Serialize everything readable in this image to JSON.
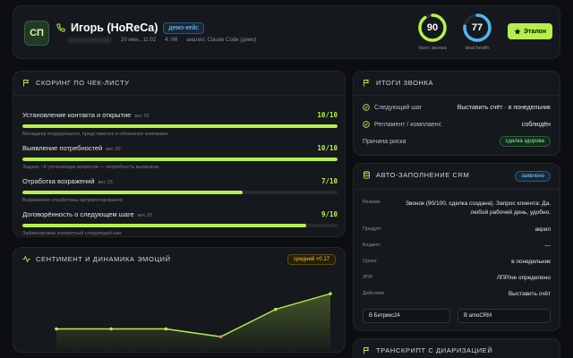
{
  "header": {
    "avatar": "СП",
    "client_name": "Игорь (HoReCa)",
    "demo_tag": "демо-кейс",
    "datetime": "20 июн., 11:02",
    "duration": "4:00",
    "analyzer": "анализ: Claude Code (демо)",
    "score": {
      "value": "90",
      "label": "балл звонка",
      "fraction": 0.9,
      "color": "#b5f04a"
    },
    "deal_health": {
      "value": "77",
      "label": "deal health",
      "fraction": 0.77,
      "color": "#4fb6f0"
    },
    "etalon_button": "Эталон"
  },
  "scoring": {
    "title": "СКОРИНГ ПО ЧЕК-ЛИСТУ",
    "criteria": [
      {
        "name": "Установление контакта и открытие",
        "weight": "вес 20",
        "score": "10/10",
        "fraction": 1.0,
        "note": "Менеджер поздоровался, представился и обозначил компанию."
      },
      {
        "name": "Выявление потребностей",
        "weight": "вес 30",
        "score": "10/10",
        "fraction": 1.0,
        "note": "Задано ~9 уточняющих вопросов — потребность выявлена."
      },
      {
        "name": "Отработка возражений",
        "weight": "вес 25",
        "score": "7/10",
        "fraction": 0.7,
        "note": "Возражения отработаны аргументированно."
      },
      {
        "name": "Договорённость о следующем шаге",
        "weight": "вес 25",
        "score": "9/10",
        "fraction": 0.9,
        "note": "Зафиксирован конкретный следующий шаг."
      }
    ]
  },
  "sentiment": {
    "title": "СЕНТИМЕНТ И ДИНАМИКА ЭМОЦИЙ",
    "badge": "средний +0.17"
  },
  "chart_data": {
    "type": "area",
    "title": "",
    "xlabel": "",
    "ylabel": "",
    "x": [
      0,
      1,
      2,
      3,
      4,
      5
    ],
    "series": [
      {
        "values": [
          0.0,
          0.0,
          0.0,
          -0.1,
          0.25,
          0.45
        ]
      }
    ],
    "ylim": [
      -0.2,
      0.6
    ],
    "point_colors": [
      "#b5f04a",
      "#b5f04a",
      "#b5f04a",
      "#f87171",
      "#b5f04a",
      "#b5f04a"
    ],
    "line_color": "#b5f04a",
    "grid": false
  },
  "summary": {
    "title": "ИТОГИ ЗВОНКА",
    "next_step_label": "Следующий шаг",
    "next_step_value": "Выставить счёт · в понедельник",
    "compliance_label": "Регламент / комплаенс",
    "compliance_value": "соблюдён",
    "risk_label": "Причина риска",
    "risk_value": "сделка здорова"
  },
  "autofill": {
    "title": "АВТО-ЗАПОЛНЕНИЕ CRM",
    "badge": "заявлено",
    "fields": [
      {
        "key": "Резюме",
        "value": "Звонок (90/100, сделка создана). Запрос клиента: Да, любой рабочий день, удобно."
      },
      {
        "key": "Продукт",
        "value": "акрил"
      },
      {
        "key": "Бюджет",
        "value": "—"
      },
      {
        "key": "Сроки",
        "value": "в понедельник"
      },
      {
        "key": "ЛПР",
        "value": "ЛПР/не определено"
      },
      {
        "key": "Действия",
        "value": "Выставить счёт"
      }
    ],
    "btn_bitrix": "В Битрикс24",
    "btn_amocrm": "В amoCRM"
  },
  "transcript": {
    "title": "ТРАНСКРИПТ С ДИАРИЗАЦИЕЙ"
  }
}
